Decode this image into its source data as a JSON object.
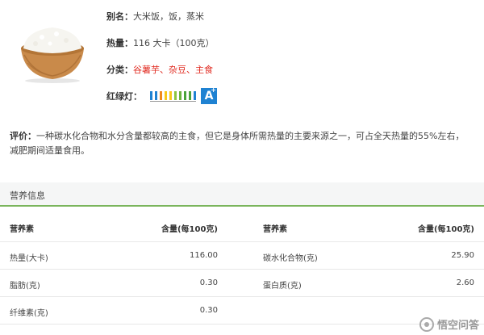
{
  "food": {
    "alias_label": "别名：",
    "alias_value": "大米饭，饭，蒸米",
    "calorie_label": "热量：",
    "calorie_value": "116 大卡（100克）",
    "category_label": "分类：",
    "category_value": "谷薯芋、杂豆、主食",
    "light_label": "红绿灯：",
    "grade": "A",
    "grade_plus": "+",
    "light_colors": [
      "#1f82d2",
      "#1f82d2",
      "#f08a1d",
      "#f7c91a",
      "#f7c91a",
      "#8dc63f",
      "#6ab43e",
      "#4aa33c",
      "#4aa33c",
      "#1f82d2"
    ],
    "accent_red": "#e0271d"
  },
  "description": {
    "label": "评价：",
    "text": "一种碳水化合物和水分含量都较高的主食，但它是身体所需热量的主要来源之一，可占全天热量的55%左右，减肥期间适量食用。"
  },
  "nutrition": {
    "title": "营养信息",
    "columns": [
      "营养素",
      "含量(每100克)",
      "营养素",
      "含量(每100克)"
    ],
    "rows": [
      [
        "热量(大卡)",
        "116.00",
        "碳水化合物(克)",
        "25.90"
      ],
      [
        "脂肪(克)",
        "0.30",
        "蛋白质(克)",
        "2.60"
      ],
      [
        "纤维素(克)",
        "0.30",
        "",
        ""
      ]
    ]
  },
  "watermark": {
    "text": "悟空问答"
  }
}
